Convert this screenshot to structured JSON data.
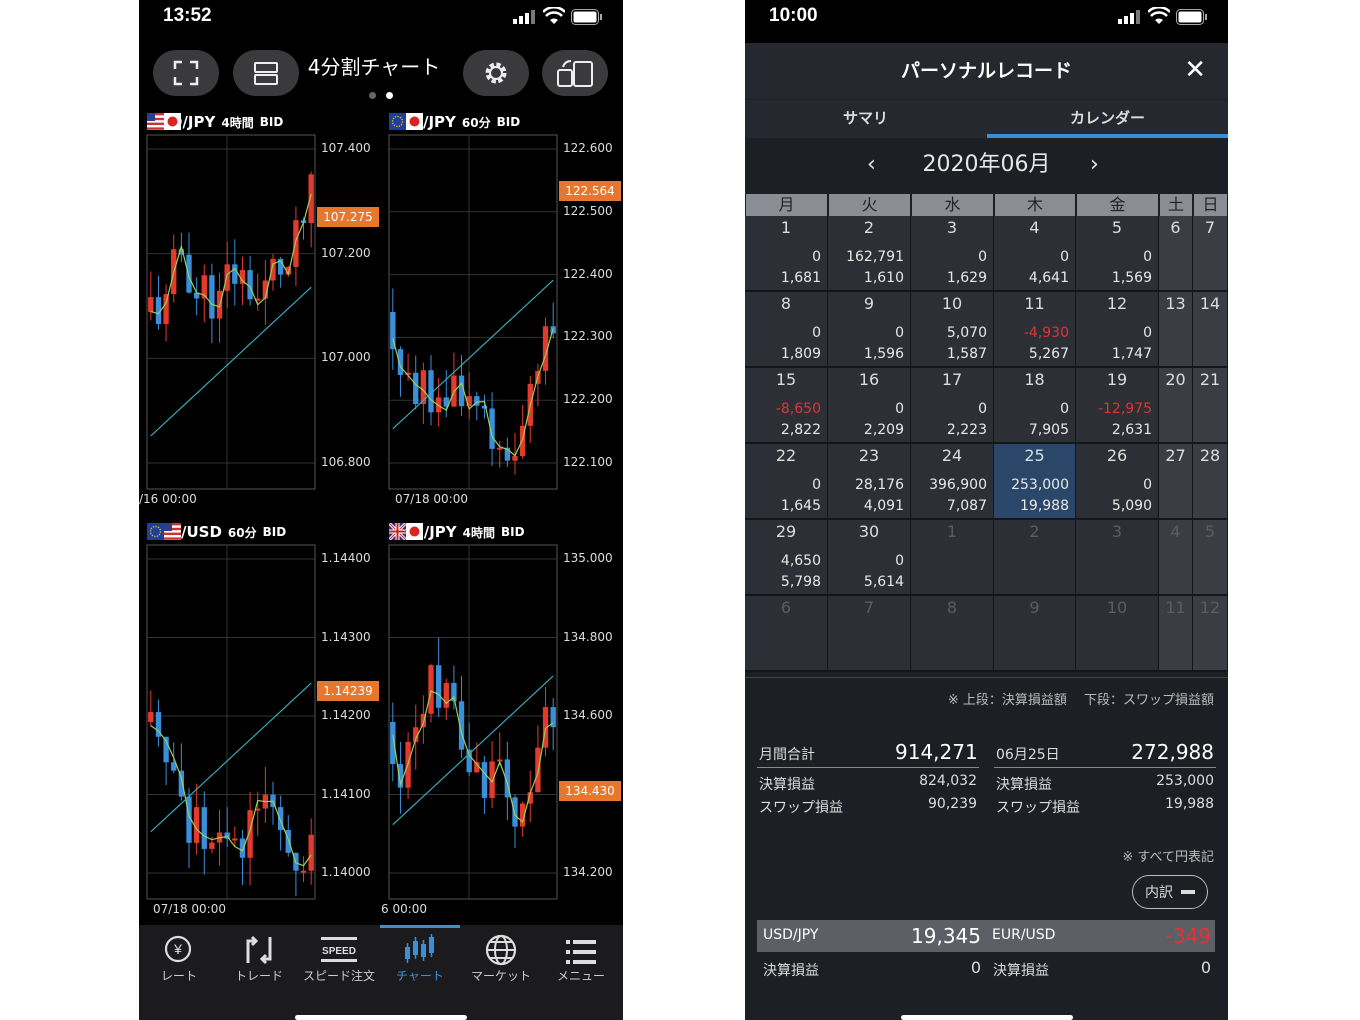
{
  "left_phone": {
    "status_time": "13:52",
    "header_title": "4分割チャート",
    "charts": [
      {
        "pair": "USD/JPY",
        "timeframe": "4時間",
        "side": "BID",
        "prices": [
          "107.400",
          "107.200",
          "107.000",
          "106.800"
        ],
        "current": "107.275",
        "date": "/16 00:00"
      },
      {
        "pair": "EUR/JPY",
        "timeframe": "60分",
        "side": "BID",
        "prices": [
          "122.600",
          "122.500",
          "122.400",
          "122.300",
          "122.200",
          "122.100"
        ],
        "current": "122.564",
        "date": "07/18 00:00"
      },
      {
        "pair": "EUR/USD",
        "timeframe": "60分",
        "side": "BID",
        "prices": [
          "1.14400",
          "1.14300",
          "1.14200",
          "1.14100",
          "1.14000"
        ],
        "current": "1.14239",
        "date": "07/18 00:00"
      },
      {
        "pair": "GBP/JPY",
        "timeframe": "4時間",
        "side": "BID",
        "prices": [
          "135.000",
          "134.800",
          "134.600",
          "134.400",
          "134.200"
        ],
        "current": "134.430",
        "date": "6 00:00"
      }
    ],
    "tabs": [
      "レート",
      "トレード",
      "スピード注文",
      "チャート",
      "マーケット",
      "メニュー"
    ],
    "speed_icon_text": "SPEED",
    "rate_icon_text": "¥"
  },
  "right_phone": {
    "status_time": "10:00",
    "title": "パーソナルレコード",
    "close": "✕",
    "tabs": [
      "サマリ",
      "カレンダー"
    ],
    "month": "2020年06月",
    "prev": "‹",
    "next": "›",
    "weekdays": [
      "月",
      "火",
      "水",
      "木",
      "金",
      "土",
      "日"
    ],
    "weeks": [
      [
        {
          "d": "1",
          "a": "0",
          "b": "1,681"
        },
        {
          "d": "2",
          "a": "162,791",
          "b": "1,610"
        },
        {
          "d": "3",
          "a": "0",
          "b": "1,629"
        },
        {
          "d": "4",
          "a": "0",
          "b": "4,641"
        },
        {
          "d": "5",
          "a": "0",
          "b": "1,569"
        },
        {
          "d": "6"
        },
        {
          "d": "7"
        }
      ],
      [
        {
          "d": "8",
          "a": "0",
          "b": "1,809"
        },
        {
          "d": "9",
          "a": "0",
          "b": "1,596"
        },
        {
          "d": "10",
          "a": "5,070",
          "b": "1,587"
        },
        {
          "d": "11",
          "a": "-4,930",
          "b": "5,267"
        },
        {
          "d": "12",
          "a": "0",
          "b": "1,747"
        },
        {
          "d": "13"
        },
        {
          "d": "14"
        }
      ],
      [
        {
          "d": "15",
          "a": "-8,650",
          "b": "2,822"
        },
        {
          "d": "16",
          "a": "0",
          "b": "2,209"
        },
        {
          "d": "17",
          "a": "0",
          "b": "2,223"
        },
        {
          "d": "18",
          "a": "0",
          "b": "7,905"
        },
        {
          "d": "19",
          "a": "-12,975",
          "b": "2,631"
        },
        {
          "d": "20"
        },
        {
          "d": "21"
        }
      ],
      [
        {
          "d": "22",
          "a": "0",
          "b": "1,645"
        },
        {
          "d": "23",
          "a": "28,176",
          "b": "4,091"
        },
        {
          "d": "24",
          "a": "396,900",
          "b": "7,087"
        },
        {
          "d": "25",
          "a": "253,000",
          "b": "19,988",
          "sel": true
        },
        {
          "d": "26",
          "a": "0",
          "b": "5,090"
        },
        {
          "d": "27"
        },
        {
          "d": "28"
        }
      ],
      [
        {
          "d": "29",
          "a": "4,650",
          "b": "5,798"
        },
        {
          "d": "30",
          "a": "0",
          "b": "5,614"
        },
        {
          "d": "1",
          "o": true
        },
        {
          "d": "2",
          "o": true
        },
        {
          "d": "3",
          "o": true
        },
        {
          "d": "4",
          "o": true
        },
        {
          "d": "5",
          "o": true
        }
      ],
      [
        {
          "d": "6",
          "o": true
        },
        {
          "d": "7",
          "o": true
        },
        {
          "d": "8",
          "o": true
        },
        {
          "d": "9",
          "o": true
        },
        {
          "d": "10",
          "o": true
        },
        {
          "d": "11",
          "o": true
        },
        {
          "d": "12",
          "o": true
        }
      ]
    ],
    "note_top": "※ 上段：決算損益額　 下段：スワップ損益額",
    "month_total_label": "月間合計",
    "month_total": "914,271",
    "month_kessan_label": "決算損益",
    "month_kessan": "824,032",
    "month_swap_label": "スワップ損益",
    "month_swap": "90,239",
    "day_label": "06月25日",
    "day_total": "272,988",
    "day_kessan_label": "決算損益",
    "day_kessan": "253,000",
    "day_swap_label": "スワップ損益",
    "day_swap": "19,988",
    "note_yen": "※ すべて円表記",
    "breakdown_button": "内訳",
    "breakdown": {
      "pair1": "USD/JPY",
      "val1": "19,345",
      "pair2": "EUR/USD",
      "val2": "-349",
      "row2_label": "決算損益",
      "row2_v1": "0",
      "row2_v2": "0"
    },
    "colors": {
      "negative": "#e03434",
      "accent": "#3b8fd9",
      "orange": "#e8772e"
    }
  }
}
